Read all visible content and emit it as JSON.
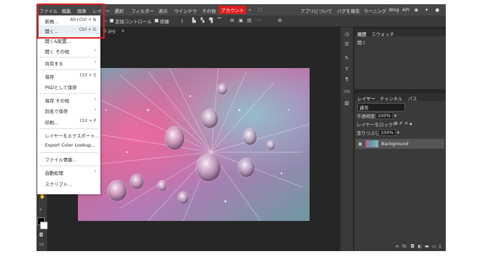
{
  "menubar": {
    "items": [
      "ファイル",
      "編集",
      "画像",
      "レイ",
      "ー",
      "選択",
      "フィルター",
      "表示",
      "ウインドウ",
      "その他",
      "アカウント"
    ],
    "right_items": [
      "アプリについて",
      "バグを報告",
      "ラーニング",
      "Blog",
      "API"
    ]
  },
  "toolbar": {
    "transform_label": "変換コントロール",
    "distance_label": "距離"
  },
  "document_tab": {
    "name": "1.jpg",
    "close": "×"
  },
  "file_menu": {
    "items": [
      {
        "label": "新規...",
        "shortcut": "Alt+Ctrl + N"
      },
      {
        "label": "開く...",
        "shortcut": "Ctrl + O"
      },
      {
        "label": "開く&配置...",
        "shortcut": ""
      },
      {
        "label": "開く その他",
        "shortcut": "›"
      },
      {
        "label": "共有する",
        "shortcut": "›"
      },
      {
        "label": "保存",
        "shortcut": "Ctrl + S"
      },
      {
        "label": "PSDとして保存",
        "shortcut": ""
      },
      {
        "label": "保存 その他",
        "shortcut": "›"
      },
      {
        "label": "別名で保存",
        "shortcut": "›"
      },
      {
        "label": "印刷...",
        "shortcut": "Ctrl + P"
      },
      {
        "label": "レイヤーをエクスポート...",
        "shortcut": ""
      },
      {
        "label": "Export Color Lookup...",
        "shortcut": ""
      },
      {
        "label": "ファイル情報...",
        "shortcut": ""
      },
      {
        "label": "自動処理",
        "shortcut": "›"
      },
      {
        "label": "スクリプト...",
        "shortcut": ""
      }
    ]
  },
  "history_panel": {
    "tabs": [
      "履歴",
      "スウォッチ"
    ],
    "entries": [
      "開く"
    ]
  },
  "layers_panel": {
    "tabs": [
      "レイヤー",
      "チャンネル",
      "パス"
    ],
    "blend_mode": "通常",
    "opacity_label": "不透明度:",
    "opacity_value": "100%",
    "lock_label": "レイヤーをロック:",
    "fill_label": "塗りつぶし:",
    "fill_value": "100%",
    "layer_name": "Background"
  },
  "colors": {
    "accent": "#d92020",
    "highlight_box": "#e02020",
    "panel_bg": "#3a3a3a",
    "app_bg": "#262626"
  }
}
